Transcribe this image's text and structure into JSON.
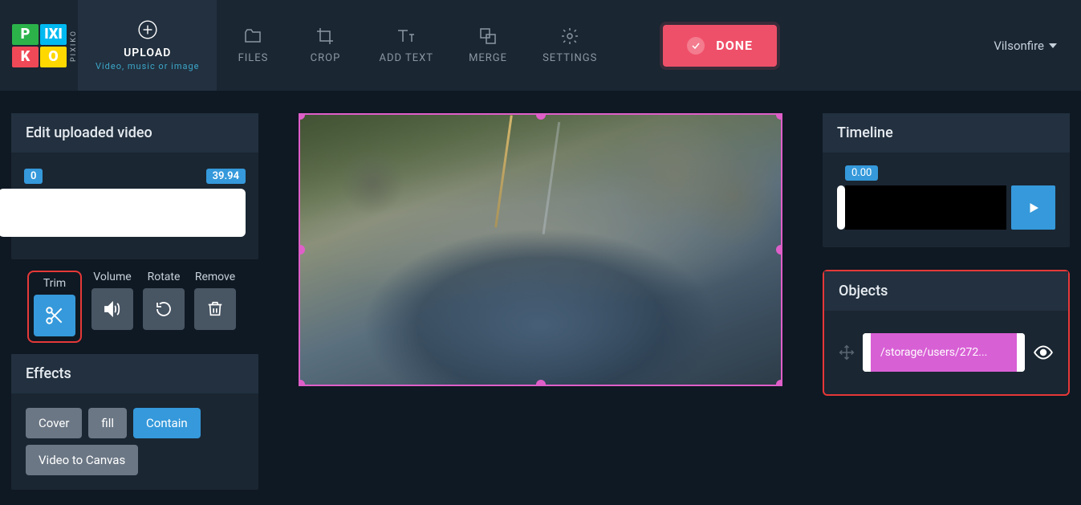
{
  "header": {
    "logo_side": "PIXIKO",
    "nav": {
      "upload": {
        "title": "UPLOAD",
        "sub": "Video, music or image"
      },
      "files": "FILES",
      "crop": "CROP",
      "addtext": "ADD TEXT",
      "merge": "MERGE",
      "settings": "SETTINGS"
    },
    "done": "DONE",
    "user": "Vilsonfire"
  },
  "edit_panel": {
    "title": "Edit uploaded video",
    "range_start": "0",
    "range_end": "39.94"
  },
  "tools": {
    "trim": "Trim",
    "volume": "Volume",
    "rotate": "Rotate",
    "remove": "Remove"
  },
  "effects": {
    "title": "Effects",
    "cover": "Cover",
    "fill": "fill",
    "contain": "Contain",
    "video_to_canvas": "Video to Canvas"
  },
  "timeline": {
    "title": "Timeline",
    "time": "0.00"
  },
  "objects": {
    "title": "Objects",
    "item": "/storage/users/272..."
  }
}
